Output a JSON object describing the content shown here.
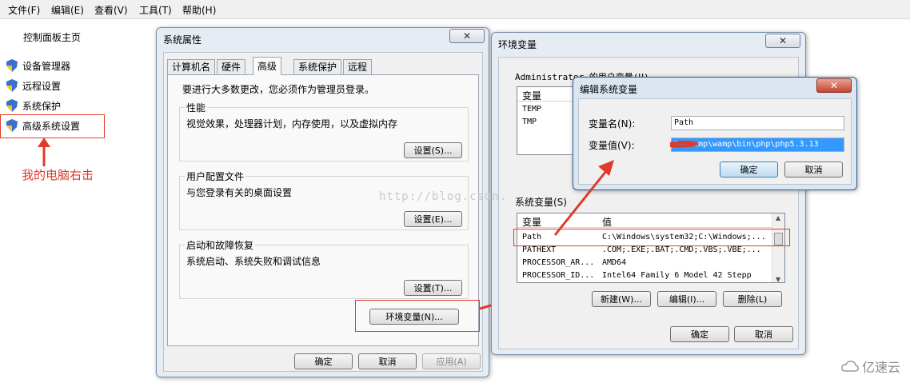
{
  "menu": [
    "文件(F)",
    "编辑(E)",
    "查看(V)",
    "工具(T)",
    "帮助(H)"
  ],
  "left_pane": {
    "home": "控制面板主页",
    "items": [
      "设备管理器",
      "远程设置",
      "系统保护",
      "高级系统设置"
    ]
  },
  "annotation": "我的电脑右击",
  "sysprops": {
    "title": "系统属性",
    "close": "✕",
    "tabs": [
      "计算机名",
      "硬件",
      "高级",
      "系统保护",
      "远程"
    ],
    "admin_note": "要进行大多数更改，您必须作为管理员登录。",
    "perf": {
      "label": "性能",
      "desc": "视觉效果，处理器计划，内存使用，以及虚拟内存",
      "button": "设置(S)..."
    },
    "profile": {
      "label": "用户配置文件",
      "desc": "与您登录有关的桌面设置",
      "button": "设置(E)..."
    },
    "startup": {
      "label": "启动和故障恢复",
      "desc": "系统启动、系统失败和调试信息",
      "button": "设置(T)..."
    },
    "env_button": "环境变量(N)...",
    "ok": "确定",
    "cancel": "取消",
    "apply": "应用(A)"
  },
  "envvars": {
    "title": "环境变量",
    "close": "✕",
    "user_label": "Administrator 的用户变量(U)",
    "user_col": "变量",
    "user_rows": [
      "TEMP",
      "TMP"
    ],
    "sys_label": "系统变量(S)",
    "sys_cols": [
      "变量",
      "值"
    ],
    "sys_rows": [
      {
        "name": "Path",
        "value": "C:\\Windows\\system32;C:\\Windows;..."
      },
      {
        "name": "PATHEXT",
        "value": ".COM;.EXE;.BAT;.CMD;.VBS;.VBE;..."
      },
      {
        "name": "PROCESSOR_AR...",
        "value": "AMD64"
      },
      {
        "name": "PROCESSOR_ID...",
        "value": "Intel64 Family 6 Model 42 Stepp"
      }
    ],
    "new": "新建(W)...",
    "edit": "编辑(I)...",
    "delete": "删除(L)",
    "ok": "确定",
    "cancel": "取消"
  },
  "editvar": {
    "title": "编辑系统变量",
    "close": "✕",
    "name_label": "变量名(N):",
    "name_value": "Path",
    "value_label": "变量值(V):",
    "value_value": "D:\\wamp\\wamp\\bin\\php\\php5.3.13",
    "ok": "确定",
    "cancel": "取消"
  },
  "watermark": "http://blog.csdn.",
  "logo_text": "亿速云",
  "colors": {
    "annotation": "#e03a2a",
    "selection": "#3399ff"
  }
}
